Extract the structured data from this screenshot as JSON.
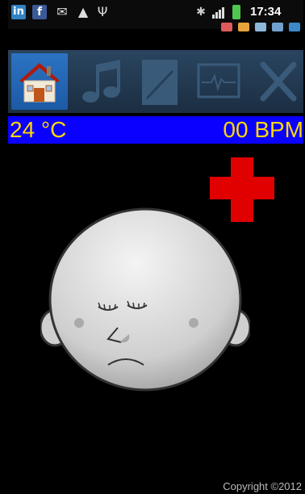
{
  "status": {
    "time": "17:34",
    "icons": [
      "linkedin-icon",
      "facebook-icon",
      "mail-icon",
      "warning-icon",
      "usb-icon",
      "bluetooth-icon",
      "signal-icon",
      "battery-icon"
    ]
  },
  "tabs": [
    {
      "name": "home",
      "active": true
    },
    {
      "name": "music",
      "active": false
    },
    {
      "name": "notes",
      "active": false
    },
    {
      "name": "monitor",
      "active": false
    },
    {
      "name": "settings",
      "active": false
    }
  ],
  "readings": {
    "temperature": "24 °C",
    "heart_rate": "00 BPM"
  },
  "footer": {
    "copyright": "Copyright ©2012"
  },
  "colors": {
    "accent": "#0a00ff",
    "reading_text": "#ffd700",
    "cross": "#e00000",
    "tab_active": "#2c73c2"
  }
}
